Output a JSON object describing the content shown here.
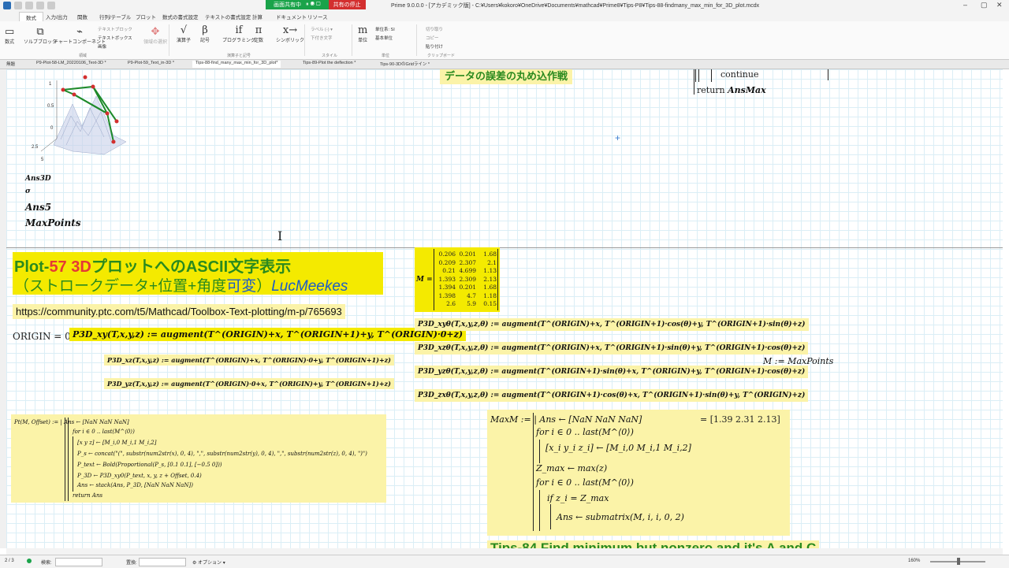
{
  "titlebar": {
    "share_status": "画面共有中",
    "share_stop": "共有の停止",
    "doc_title": "Prime 9.0.0.0 - [アカデミック版] - C:¥Users¥kokoro¥OneDrive¥Documents¥mathcad¥Prime8¥Tips-P8¥Tips-88-findmany_max_min_for_3D_plot.mcdx"
  },
  "ribbon_tabs": [
    "数式",
    "入力/出力",
    "関数",
    "行列/テーブル",
    "プロット",
    "数式の書式設定",
    "テキストの書式設定",
    "計算",
    "ドキュメント",
    "リソース"
  ],
  "ribbon": {
    "math_btn": "数式",
    "solve_block": "ソルブブロック",
    "chart_comp": "チャートコンポーネント",
    "text_block": "テキストブロック",
    "text_box": "テキストボックス",
    "image": "画像",
    "region_select": "領域の選択",
    "group_regions": "領域",
    "operators": "演算子",
    "symbols": "記号",
    "programming": "プログラミング",
    "constants": "定数",
    "symbolic": "シンボリック",
    "group_ops": "演算子と記号",
    "label": "ラベル",
    "label_value": "(-)",
    "subscript": "下付き文字",
    "group_style": "スタイル",
    "unit": "単位",
    "unit_system": "単位系: SI",
    "base_unit": "基本単位",
    "group_units": "単位",
    "cut": "切り取り",
    "copy": "コピー",
    "paste": "貼り付け",
    "group_clipboard": "クリップボード"
  },
  "doc_tabs": [
    "無題",
    "P9-Plot-58-LM_20220106_Text-3D *",
    "P9-Plot-59_Text_in-3D *",
    "Tips-88-find_many_max_min_for_3D_plot*",
    "Tips-89-Plot the deflection *",
    "Tips-90-3DのGridライン *"
  ],
  "worksheet": {
    "title_jp_top": "データの誤差の丸め込作戦",
    "prog_continue": "continue",
    "prog_return": "return",
    "prog_return_var": "AnsMax",
    "var_list": [
      "Ans3D",
      "σ",
      "Ans5",
      "MaxPoints"
    ],
    "plot_ticks": [
      "1",
      "0.5",
      "0",
      "2.5",
      "5"
    ],
    "heading1_prefix": "Plot-",
    "heading1_num": "57",
    "heading1_3d": "3D",
    "heading1_rest": "プロットへのASCII文字表示",
    "heading2_open": "（ストロークデータ+位置+角度",
    "heading2_var": "可変",
    "heading2_close": "）",
    "heading2_author": "LucMeekes",
    "url": "https://community.ptc.com/t5/Mathcad/Toolbox-Text-plotting/m-p/765693",
    "origin": "ORIGIN = 0",
    "p3d_xy": "P3D_xy(T,x,y,z) := augment(T^(ORIGIN)+x, T^(ORIGIN+1)+y, T^(ORIGIN)·0+z)",
    "p3d_xz": "P3D_xz(T,x,y,z) := augment(T^(ORIGIN)+x, T^(ORIGIN)·0+y, T^(ORIGIN+1)+z)",
    "p3d_yz": "P3D_yz(T,x,y,z) := augment(T^(ORIGIN)·0+x, T^(ORIGIN)+y, T^(ORIGIN+1)+z)",
    "pt_lines": [
      "Pt(M, Offset) := | Ans ← [NaN  NaN  NaN]",
      "for i ∈ 0 .. last(M^⟨0⟩)",
      "[x  y  z] ← [M_i,0  M_i,1  M_i,2]",
      "P_s ← concat(\"(\", substr(num2str(x), 0, 4), \",\", substr(num2str(y), 0, 4), \",\", substr(num2str(z), 0, 4), \")\")",
      "P_text ← Bold(Proportional(P_s, [0.1 0.1], [−0.5 0]))",
      "P_3D ← P3D_xy0(P_text, x, y, z + Offset, 0.4)",
      "Ans ← stack(Ans, P_3D, [NaN  NaN  NaN])",
      "return Ans"
    ],
    "matrix_label": "M =",
    "matrix": [
      [
        "0.206",
        "0.201",
        "1.68"
      ],
      [
        "0.209",
        "2.307",
        "2.1"
      ],
      [
        "0.21",
        "4.699",
        "1.13"
      ],
      [
        "1.393",
        "2.309",
        "2.13"
      ],
      [
        "1.394",
        "0.201",
        "1.68"
      ],
      [
        "1.398",
        "4.7",
        "1.18"
      ],
      [
        "2.6",
        "5.9",
        "0.15"
      ]
    ],
    "p3d_xy0": "P3D_xyθ(T,x,y,z,θ) := augment(T^(ORIGIN)+x, T^(ORIGIN+1)·cos(θ)+y, T^(ORIGIN+1)·sin(θ)+z)",
    "p3d_xz0": "P3D_xzθ(T,x,y,z,θ) := augment(T^(ORIGIN)+x, T^(ORIGIN+1)·sin(θ)+y, T^(ORIGIN+1)·cos(θ)+z)",
    "p3d_yz0": "P3D_yzθ(T,x,y,z,θ) := augment(T^(ORIGIN+1)·sin(θ)+x, T^(ORIGIN)+y, T^(ORIGIN+1)·cos(θ)+z)",
    "p3d_zx0": "P3D_zxθ(T,x,y,z,θ) := augment(T^(ORIGIN+1)·cos(θ)+x, T^(ORIGIN+1)·sin(θ)+y, T^(ORIGIN)+z)",
    "m_assign": "M := MaxPoints",
    "maxm_lines": [
      "MaxM := | Ans ← [NaN  NaN  NaN]",
      "for i ∈ 0 .. last(M^⟨0⟩)",
      "[x_i  y_i  z_i] ← [M_i,0  M_i,1  M_i,2]",
      "Z_max ← max(z)",
      "for i ∈ 0 .. last(M^⟨0⟩)",
      "if z_i = Z_max",
      "Ans ← submatrix(M, i, i, 0, 2)"
    ],
    "maxm_result": "= [1.39  2.31  2.13]",
    "tips_heading": "Tips-84  Find minimum but nonzero and it's A and C"
  },
  "status": {
    "page": "2 / 3",
    "search_label": "検索:",
    "replace_label": "置換:",
    "options": "オプション",
    "zoom": "160%"
  },
  "colors": {
    "accent_green": "#1aa34a",
    "highlight_yellow": "#f4ea00",
    "light_yellow": "#fbf3a8",
    "heading_green": "#2a8a1e",
    "heading_red": "#e53935",
    "heading_blue": "#1c5cc7"
  }
}
